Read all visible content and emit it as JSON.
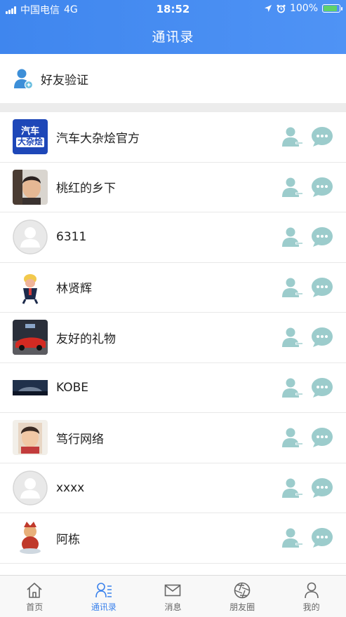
{
  "status_bar": {
    "carrier": "中国电信",
    "network": "4G",
    "time": "18:52",
    "battery": "100%",
    "battery_level": 1.0
  },
  "header": {
    "title": "通讯录"
  },
  "friend_verify": {
    "label": "好友验证",
    "icon": "user-add-icon"
  },
  "contacts": [
    {
      "name": "汽车大杂烩官方",
      "avatar": "logo"
    },
    {
      "name": "桃红的乡下",
      "avatar": "photo-boy"
    },
    {
      "name": "6311",
      "avatar": "default"
    },
    {
      "name": "林贤辉",
      "avatar": "cartoon"
    },
    {
      "name": "友好的礼物",
      "avatar": "photo-car"
    },
    {
      "name": "KOBE",
      "avatar": "photo-wide"
    },
    {
      "name": "笃行网络",
      "avatar": "photo-kid"
    },
    {
      "name": "xxxx",
      "avatar": "default"
    },
    {
      "name": "阿栋",
      "avatar": "cartoon-2"
    }
  ],
  "avatar_logo_text": [
    "汽车",
    "大杂烩"
  ],
  "tabs": [
    {
      "label": "首页",
      "icon": "home-icon",
      "active": false
    },
    {
      "label": "通讯录",
      "icon": "contacts-icon",
      "active": true
    },
    {
      "label": "消息",
      "icon": "mail-icon",
      "active": false
    },
    {
      "label": "朋友圈",
      "icon": "aperture-icon",
      "active": false
    },
    {
      "label": "我的",
      "icon": "person-icon",
      "active": false
    }
  ],
  "colors": {
    "accent": "#3b82ec",
    "action_icon": "#9ccccc",
    "separator": "#ececec"
  }
}
